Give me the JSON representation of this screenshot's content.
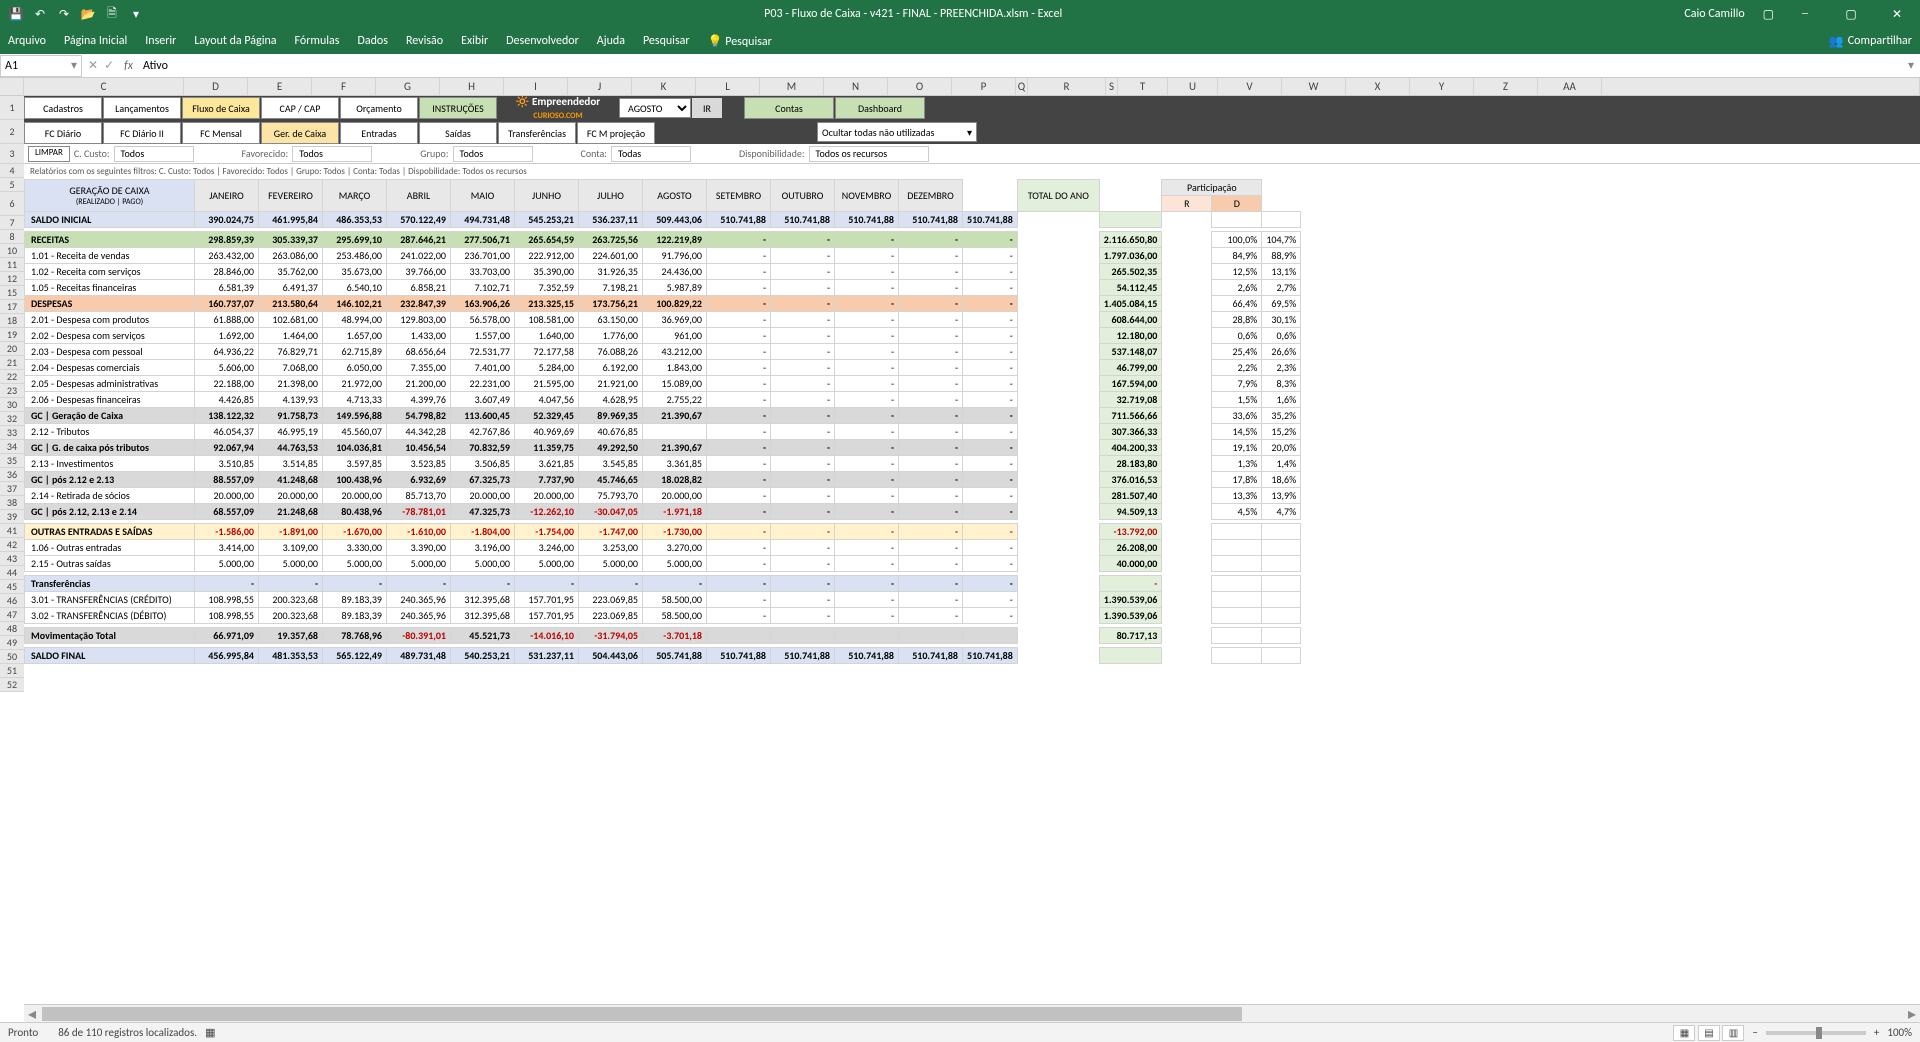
{
  "app": {
    "title": "P03 - Fluxo de Caixa - v421 - FINAL - PREENCHIDA.xlsm  -  Excel",
    "user": "Caio Camillo"
  },
  "ribbon": {
    "tabs": [
      "Arquivo",
      "Página Inicial",
      "Inserir",
      "Layout da Página",
      "Fórmulas",
      "Dados",
      "Revisão",
      "Exibir",
      "Desenvolvedor",
      "Ajuda",
      "Pesquisar"
    ],
    "tell_me": "Pesquisar",
    "share": "Compartilhar"
  },
  "formula": {
    "name_box": "A1",
    "value": "Ativo"
  },
  "col_labels": [
    "C",
    "D",
    "E",
    "F",
    "G",
    "H",
    "I",
    "J",
    "K",
    "L",
    "M",
    "N",
    "O",
    "P",
    "Q",
    "R",
    "S",
    "T",
    "U",
    "V",
    "W",
    "X",
    "Y",
    "Z",
    "AA"
  ],
  "row_labels": [
    "1",
    "2",
    "3",
    "4",
    "5",
    "6",
    "7",
    "8",
    "10",
    "11",
    "12",
    "15",
    "17",
    "18",
    "19",
    "20",
    "21",
    "22",
    "23",
    "30",
    "32",
    "33",
    "34",
    "35",
    "36",
    "37",
    "38",
    "39",
    "41",
    "42",
    "43",
    "44",
    "45",
    "46",
    "47",
    "48",
    "49",
    "50",
    "51",
    "52"
  ],
  "nav1": {
    "cadastros": "Cadastros",
    "lancamentos": "Lançamentos",
    "fluxo": "Fluxo de Caixa",
    "cap": "CAP / CAP",
    "orcamento": "Orçamento",
    "instrucoes": "INSTRUÇÕES",
    "mes": "AGOSTO",
    "ir": "IR",
    "contas": "Contas",
    "dashboard": "Dashboard"
  },
  "nav2": {
    "fcdiario": "FC Diário",
    "fcdiario2": "FC Diário II",
    "fcmensal": "FC Mensal",
    "gercaixa": "Ger. de Caixa",
    "entradas": "Entradas",
    "saidas": "Saídas",
    "transf": "Transferências",
    "fcproj": "FC M projeção",
    "ocultar": "Ocultar todas não utilizadas"
  },
  "filters": {
    "limpar": "LIMPAR",
    "ccusto_lbl": "C. Custo:",
    "ccusto": "Todos",
    "fav_lbl": "Favorecido:",
    "fav": "Todos",
    "grupo_lbl": "Grupo:",
    "grupo": "Todos",
    "conta_lbl": "Conta:",
    "conta": "Todas",
    "disp_lbl": "Disponibilidade:",
    "disp": "Todos os recursos",
    "text": "Relatórios com os seguintes filtros: C. Custo: Todos | Favorecido: Todos | Grupo: Todos | Conta: Todas | Dispobilidade: Todos os recursos"
  },
  "headers": {
    "main": "GERAÇÃO DE CAIXA",
    "sub": "(REALIZADO | PAGO)",
    "months": [
      "JANEIRO",
      "FEVEREIRO",
      "MARÇO",
      "ABRIL",
      "MAIO",
      "JUNHO",
      "JULHO",
      "AGOSTO",
      "SETEMBRO",
      "OUTUBRO",
      "NOVEMBRO",
      "DEZEMBRO"
    ],
    "total": "TOTAL DO ANO",
    "part": "Participação",
    "r": "R",
    "d": "D"
  },
  "rows": [
    {
      "k": "saldo_inicial",
      "lbl": "SALDO INICIAL",
      "cls": "section-blue",
      "v": [
        "390.024,75",
        "461.995,84",
        "486.353,53",
        "570.122,49",
        "494.731,48",
        "545.253,21",
        "536.237,11",
        "509.443,06",
        "510.741,88",
        "510.741,88",
        "510.741,88",
        "510.741,88",
        "510.741,88"
      ],
      "tot": "",
      "r": "",
      "d": ""
    },
    {
      "k": "receitas",
      "lbl": "RECEITAS",
      "cls": "section-green",
      "v": [
        "298.859,39",
        "305.339,37",
        "295.699,10",
        "287.646,21",
        "277.506,71",
        "265.654,59",
        "263.725,56",
        "122.219,89",
        "-",
        "-",
        "-",
        "-",
        "-"
      ],
      "tot": "2.116.650,80",
      "r": "100,0%",
      "d": "104,7%"
    },
    {
      "k": "r101",
      "lbl": "1.01 - Receita de vendas",
      "v": [
        "263.432,00",
        "263.086,00",
        "253.486,00",
        "241.022,00",
        "236.701,00",
        "222.912,00",
        "224.601,00",
        "91.796,00",
        "-",
        "-",
        "-",
        "-",
        "-"
      ],
      "tot": "1.797.036,00",
      "r": "84,9%",
      "d": "88,9%"
    },
    {
      "k": "r102",
      "lbl": "1.02 - Receita com serviços",
      "v": [
        "28.846,00",
        "35.762,00",
        "35.673,00",
        "39.766,00",
        "33.703,00",
        "35.390,00",
        "31.926,35",
        "24.436,00",
        "-",
        "-",
        "-",
        "-",
        "-"
      ],
      "tot": "265.502,35",
      "r": "12,5%",
      "d": "13,1%"
    },
    {
      "k": "r105",
      "lbl": "1.05 - Receitas financeiras",
      "v": [
        "6.581,39",
        "6.491,37",
        "6.540,10",
        "6.858,21",
        "7.102,71",
        "7.352,59",
        "7.198,21",
        "5.987,89",
        "-",
        "-",
        "-",
        "-",
        "-"
      ],
      "tot": "54.112,45",
      "r": "2,6%",
      "d": "2,7%"
    },
    {
      "k": "despesas",
      "lbl": "DESPESAS",
      "cls": "section-orange",
      "v": [
        "160.737,07",
        "213.580,64",
        "146.102,21",
        "232.847,39",
        "163.906,26",
        "213.325,15",
        "173.756,21",
        "100.829,22",
        "-",
        "-",
        "-",
        "-",
        "-"
      ],
      "tot": "1.405.084,15",
      "r": "66,4%",
      "d": "69,5%"
    },
    {
      "k": "d201",
      "lbl": "2.01 - Despesa com produtos",
      "v": [
        "61.888,00",
        "102.681,00",
        "48.994,00",
        "129.803,00",
        "56.578,00",
        "108.581,00",
        "63.150,00",
        "36.969,00",
        "-",
        "-",
        "-",
        "-",
        "-"
      ],
      "tot": "608.644,00",
      "r": "28,8%",
      "d": "30,1%"
    },
    {
      "k": "d202",
      "lbl": "2.02 - Despesa com serviços",
      "v": [
        "1.692,00",
        "1.464,00",
        "1.657,00",
        "1.433,00",
        "1.557,00",
        "1.640,00",
        "1.776,00",
        "961,00",
        "-",
        "-",
        "-",
        "-",
        "-"
      ],
      "tot": "12.180,00",
      "r": "0,6%",
      "d": "0,6%"
    },
    {
      "k": "d203",
      "lbl": "2.03 - Despesa com pessoal",
      "v": [
        "64.936,22",
        "76.829,71",
        "62.715,89",
        "68.656,64",
        "72.531,77",
        "72.177,58",
        "76.088,26",
        "43.212,00",
        "-",
        "-",
        "-",
        "-",
        "-"
      ],
      "tot": "537.148,07",
      "r": "25,4%",
      "d": "26,6%"
    },
    {
      "k": "d204",
      "lbl": "2.04 - Despesas comerciais",
      "v": [
        "5.606,00",
        "7.068,00",
        "6.050,00",
        "7.355,00",
        "7.401,00",
        "5.284,00",
        "6.192,00",
        "1.843,00",
        "-",
        "-",
        "-",
        "-",
        "-"
      ],
      "tot": "46.799,00",
      "r": "2,2%",
      "d": "2,3%"
    },
    {
      "k": "d205",
      "lbl": "2.05 - Despesas administrativas",
      "v": [
        "22.188,00",
        "21.398,00",
        "21.972,00",
        "21.200,00",
        "22.231,00",
        "21.595,00",
        "21.921,00",
        "15.089,00",
        "-",
        "-",
        "-",
        "-",
        "-"
      ],
      "tot": "167.594,00",
      "r": "7,9%",
      "d": "8,3%"
    },
    {
      "k": "d206",
      "lbl": "2.06 - Despesas financeiras",
      "v": [
        "4.426,85",
        "4.139,93",
        "4.713,33",
        "4.399,76",
        "3.607,49",
        "4.047,56",
        "4.628,95",
        "2.755,22",
        "-",
        "-",
        "-",
        "-",
        "-"
      ],
      "tot": "32.719,08",
      "r": "1,5%",
      "d": "1,6%"
    },
    {
      "k": "gc1",
      "lbl": "GC | Geração de Caixa",
      "cls": "section-gray",
      "v": [
        "138.122,32",
        "91.758,73",
        "149.596,88",
        "54.798,82",
        "113.600,45",
        "52.329,45",
        "89.969,35",
        "21.390,67",
        "-",
        "-",
        "-",
        "-",
        "-"
      ],
      "tot": "711.566,66",
      "r": "33,6%",
      "d": "35,2%"
    },
    {
      "k": "trib",
      "lbl": "2.12 - Tributos",
      "v": [
        "46.054,37",
        "46.995,19",
        "45.560,07",
        "44.342,28",
        "42.767,86",
        "40.969,69",
        "40.676,85",
        "",
        "-",
        "-",
        "-",
        "-",
        "-"
      ],
      "tot": "307.366,33",
      "r": "14,5%",
      "d": "15,2%"
    },
    {
      "k": "gc2",
      "lbl": "GC | G. de caixa pós tributos",
      "cls": "section-gray",
      "v": [
        "92.067,94",
        "44.763,53",
        "104.036,81",
        "10.456,54",
        "70.832,59",
        "11.359,75",
        "49.292,50",
        "21.390,67",
        "-",
        "-",
        "-",
        "-",
        "-"
      ],
      "tot": "404.200,33",
      "r": "19,1%",
      "d": "20,0%"
    },
    {
      "k": "inv",
      "lbl": "2.13 - Investimentos",
      "v": [
        "3.510,85",
        "3.514,85",
        "3.597,85",
        "3.523,85",
        "3.506,85",
        "3.621,85",
        "3.545,85",
        "3.361,85",
        "-",
        "-",
        "-",
        "-",
        "-"
      ],
      "tot": "28.183,80",
      "r": "1,3%",
      "d": "1,4%"
    },
    {
      "k": "gc3",
      "lbl": "GC | pós 2.12 e 2.13",
      "cls": "section-gray",
      "v": [
        "88.557,09",
        "41.248,68",
        "100.438,96",
        "6.932,69",
        "67.325,73",
        "7.737,90",
        "45.746,65",
        "18.028,82",
        "-",
        "-",
        "-",
        "-",
        "-"
      ],
      "tot": "376.016,53",
      "r": "17,8%",
      "d": "18,6%"
    },
    {
      "k": "ret",
      "lbl": "2.14 - Retirada de sócios",
      "v": [
        "20.000,00",
        "20.000,00",
        "20.000,00",
        "85.713,70",
        "20.000,00",
        "20.000,00",
        "75.793,70",
        "20.000,00",
        "-",
        "-",
        "-",
        "-",
        "-"
      ],
      "tot": "281.507,40",
      "r": "13,3%",
      "d": "13,9%"
    },
    {
      "k": "gc4",
      "lbl": "GC | pós 2.12, 2.13 e 2.14",
      "cls": "section-gray",
      "v": [
        "68.557,09",
        "21.248,68",
        "80.438,96",
        "-78.781,01",
        "47.325,73",
        "-12.262,10",
        "-30.047,05",
        "-1.971,18",
        "-",
        "-",
        "-",
        "-",
        "-"
      ],
      "tot": "94.509,13",
      "r": "4,5%",
      "d": "4,7%",
      "neg": [
        3,
        5,
        6,
        7
      ]
    },
    {
      "k": "outras",
      "lbl": "OUTRAS ENTRADAS E SAÍDAS",
      "cls": "section-yellow",
      "v": [
        "-1.586,00",
        "-1.891,00",
        "-1.670,00",
        "-1.610,00",
        "-1.804,00",
        "-1.754,00",
        "-1.747,00",
        "-1.730,00",
        "-",
        "-",
        "-",
        "-",
        "-"
      ],
      "tot": "-13.792,00",
      "r": "",
      "d": "",
      "allneg": true
    },
    {
      "k": "o106",
      "lbl": "1.06 - Outras entradas",
      "v": [
        "3.414,00",
        "3.109,00",
        "3.330,00",
        "3.390,00",
        "3.196,00",
        "3.246,00",
        "3.253,00",
        "3.270,00",
        "-",
        "-",
        "-",
        "-",
        "-"
      ],
      "tot": "26.208,00",
      "r": "",
      "d": ""
    },
    {
      "k": "o215",
      "lbl": "2.15 - Outras saídas",
      "v": [
        "5.000,00",
        "5.000,00",
        "5.000,00",
        "5.000,00",
        "5.000,00",
        "5.000,00",
        "5.000,00",
        "5.000,00",
        "-",
        "-",
        "-",
        "-",
        "-"
      ],
      "tot": "40.000,00",
      "r": "",
      "d": ""
    },
    {
      "k": "transf",
      "lbl": "Transferências",
      "cls": "section-blue",
      "v": [
        "-",
        "-",
        "-",
        "-",
        "-",
        "-",
        "-",
        "-",
        "-",
        "-",
        "-",
        "-",
        "-"
      ],
      "tot": "-",
      "r": "",
      "d": ""
    },
    {
      "k": "t301",
      "lbl": "3.01 - TRANSFERÊNCIAS (CRÉDITO)",
      "v": [
        "108.998,55",
        "200.323,68",
        "89.183,39",
        "240.365,96",
        "312.395,68",
        "157.701,95",
        "223.069,85",
        "58.500,00",
        "-",
        "-",
        "-",
        "-",
        "-"
      ],
      "tot": "1.390.539,06",
      "r": "",
      "d": ""
    },
    {
      "k": "t302",
      "lbl": "3.02 - TRANSFERÊNCIAS (DÉBITO)",
      "v": [
        "108.998,55",
        "200.323,68",
        "89.183,39",
        "240.365,96",
        "312.395,68",
        "157.701,95",
        "223.069,85",
        "58.500,00",
        "-",
        "-",
        "-",
        "-",
        "-"
      ],
      "tot": "1.390.539,06",
      "r": "",
      "d": ""
    },
    {
      "k": "mov",
      "lbl": "Movimentação Total",
      "cls": "section-gray",
      "v": [
        "66.971,09",
        "19.357,68",
        "78.768,96",
        "-80.391,01",
        "45.521,73",
        "-14.016,10",
        "-31.794,05",
        "-3.701,18",
        "",
        "",
        "",
        "",
        ""
      ],
      "tot": "80.717,13",
      "r": "",
      "d": "",
      "neg": [
        3,
        5,
        6,
        7
      ]
    },
    {
      "k": "saldo_final",
      "lbl": "SALDO FINAL",
      "cls": "section-blue",
      "v": [
        "456.995,84",
        "481.353,53",
        "565.122,49",
        "489.731,48",
        "540.253,21",
        "531.237,11",
        "504.443,06",
        "505.741,88",
        "510.741,88",
        "510.741,88",
        "510.741,88",
        "510.741,88",
        "510.741,88"
      ],
      "tot": "",
      "r": "",
      "d": ""
    }
  ],
  "status": {
    "ready": "Pronto",
    "records": "86 de 110 registros localizados.",
    "zoom": "100%"
  },
  "chart_data": {
    "type": "table",
    "note": "Spreadsheet cash-flow report; rows array above holds the full tabular data (months JAN–DEZ, annual total, participation R/D)."
  }
}
